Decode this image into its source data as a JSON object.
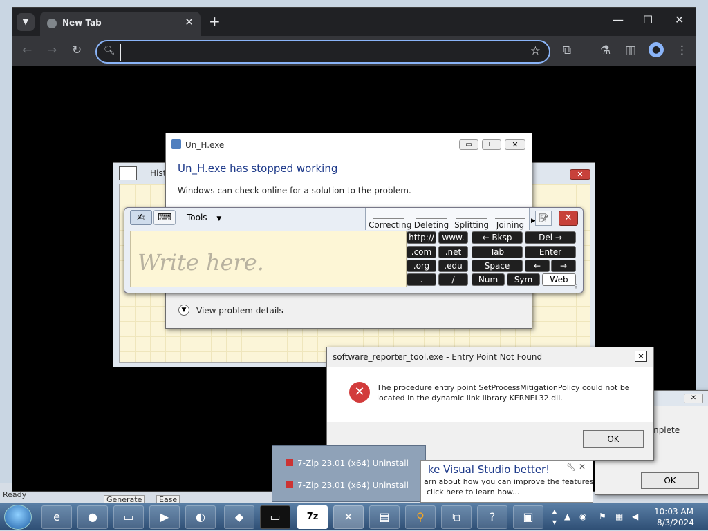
{
  "chrome": {
    "tab_title": "New Tab",
    "tab_close": "✕",
    "new_tab": "+",
    "minimize": "—",
    "maximize": "☐",
    "close": "✕",
    "omnibox_value": "",
    "omnibox_placeholder": ""
  },
  "error_dialog": {
    "title": "Un_H.exe",
    "heading": "Un_H.exe has stopped working",
    "message": "Windows can check online for a solution to the problem.",
    "details": "View problem details"
  },
  "history_window": {
    "title_partial": "Hist"
  },
  "tablet_input": {
    "tools_label": "Tools",
    "write_hint": "Write here.",
    "gestures": [
      "Correcting",
      "Deleting",
      "Splitting",
      "Joining"
    ],
    "keys": {
      "http": "http://",
      "www": "www.",
      "bksp": "←  Bksp",
      "del": "Del  →",
      "com": ".com",
      "net": ".net",
      "tab": "Tab",
      "enter": "Enter",
      "org": ".org",
      "edu": ".edu",
      "space": "Space",
      "left": "←",
      "right": "→",
      "dot": ".",
      "slash": "/",
      "num": "Num",
      "sym": "Sym",
      "web": "Web"
    }
  },
  "entry_point_dialog": {
    "title": "software_reporter_tool.exe - Entry Point Not Found",
    "message_line1": "The procedure entry point SetProcessMitigationPolicy could not be",
    "message_line2": "located in the dynamic link library KERNEL32.dll.",
    "ok": "OK"
  },
  "partial_dialog": {
    "text": "mplete",
    "ok": "OK"
  },
  "thumbnail_popup": {
    "items": [
      "7-Zip 23.01 (x64) Uninstall",
      "7-Zip 23.01 (x64) Uninstall"
    ]
  },
  "vs_balloon": {
    "title": "ke Visual Studio better!",
    "line1": "arn about how you can improve the features",
    "line2": "click here to learn how..."
  },
  "background_app": {
    "status": "Ready",
    "tab1": "Generate",
    "tab2": "Ease"
  },
  "taskbar": {
    "time": "10:03 AM",
    "date": "8/3/2024",
    "apps": [
      "ie-icon",
      "firefox-icon",
      "explorer-icon",
      "media-player-icon",
      "globe-icon",
      "installer-icon",
      "cmd-icon",
      "7zip-icon",
      "7zip-uninstall-icon",
      "notepad-icon",
      "search-icon",
      "network-tool-icon",
      "help-icon",
      "remote-desktop-icon"
    ]
  },
  "colors": {
    "chrome_tabbar": "#202124",
    "chrome_toolbar": "#35363a",
    "omnibox_focus": "#8ab4f8",
    "error_red": "#c7413a",
    "taskbar": "#3a5f88"
  }
}
